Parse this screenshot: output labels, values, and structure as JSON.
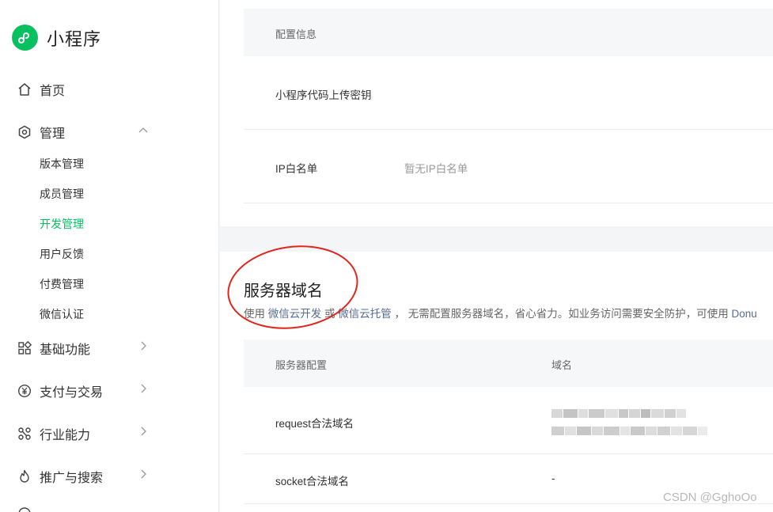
{
  "brand": {
    "name": "小程序"
  },
  "nav": {
    "home": "首页",
    "manage": "管理",
    "manage_items": [
      "版本管理",
      "成员管理",
      "开发管理",
      "用户反馈",
      "付费管理",
      "微信认证"
    ],
    "basic": "基础功能",
    "pay": "支付与交易",
    "industry": "行业能力",
    "promo": "推广与搜索"
  },
  "config": {
    "header": "配置信息",
    "upload_key_label": "小程序代码上传密钥",
    "ip_label": "IP白名单",
    "ip_value": "暂无IP白名单"
  },
  "server": {
    "title": "服务器域名",
    "desc_prefix": "使用 ",
    "link1": "微信云开发",
    "or": " 或 ",
    "link2": "微信云托管",
    "desc_suffix": " ， 无需配置服务器域名，省心省力。如业务访问需要安全防护，可使用 ",
    "link3": "Donu",
    "col1": "服务器配置",
    "col2": "域名",
    "rows": [
      {
        "label": "request合法域名",
        "value": ""
      },
      {
        "label": "socket合法域名",
        "value": "-"
      }
    ]
  },
  "watermark": "CSDN @GghoOo",
  "colors": {
    "accent": "#07c160",
    "link": "#576b95",
    "annotation": "#e1251b"
  }
}
